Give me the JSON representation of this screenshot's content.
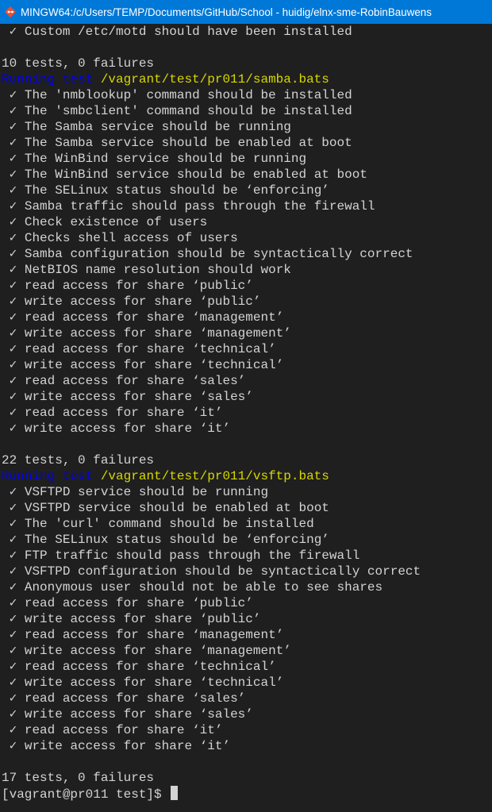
{
  "window": {
    "title": "MINGW64:/c/Users/TEMP/Documents/GitHub/School - huidig/elnx-sme-RobinBauwens",
    "icon": "git-bash-icon"
  },
  "terminal": {
    "lines": [
      {
        "kind": "pass",
        "text": " ✓ Custom /etc/motd should have been installed"
      },
      {
        "kind": "blank",
        "text": ""
      },
      {
        "kind": "summary",
        "text": "10 tests, 0 failures"
      },
      {
        "kind": "running",
        "label": "Running test",
        "path": "/vagrant/test/pr011/samba.bats"
      },
      {
        "kind": "pass",
        "text": " ✓ The 'nmblookup' command should be installed"
      },
      {
        "kind": "pass",
        "text": " ✓ The 'smbclient' command should be installed"
      },
      {
        "kind": "pass",
        "text": " ✓ The Samba service should be running"
      },
      {
        "kind": "pass",
        "text": " ✓ The Samba service should be enabled at boot"
      },
      {
        "kind": "pass",
        "text": " ✓ The WinBind service should be running"
      },
      {
        "kind": "pass",
        "text": " ✓ The WinBind service should be enabled at boot"
      },
      {
        "kind": "pass",
        "text": " ✓ The SELinux status should be ‘enforcing’"
      },
      {
        "kind": "pass",
        "text": " ✓ Samba traffic should pass through the firewall"
      },
      {
        "kind": "pass",
        "text": " ✓ Check existence of users"
      },
      {
        "kind": "pass",
        "text": " ✓ Checks shell access of users"
      },
      {
        "kind": "pass",
        "text": " ✓ Samba configuration should be syntactically correct"
      },
      {
        "kind": "pass",
        "text": " ✓ NetBIOS name resolution should work"
      },
      {
        "kind": "pass",
        "text": " ✓ read access for share ‘public’"
      },
      {
        "kind": "pass",
        "text": " ✓ write access for share ‘public’"
      },
      {
        "kind": "pass",
        "text": " ✓ read access for share ‘management’"
      },
      {
        "kind": "pass",
        "text": " ✓ write access for share ‘management’"
      },
      {
        "kind": "pass",
        "text": " ✓ read access for share ‘technical’"
      },
      {
        "kind": "pass",
        "text": " ✓ write access for share ‘technical’"
      },
      {
        "kind": "pass",
        "text": " ✓ read access for share ‘sales’"
      },
      {
        "kind": "pass",
        "text": " ✓ write access for share ‘sales’"
      },
      {
        "kind": "pass",
        "text": " ✓ read access for share ‘it’"
      },
      {
        "kind": "pass",
        "text": " ✓ write access for share ‘it’"
      },
      {
        "kind": "blank",
        "text": ""
      },
      {
        "kind": "summary",
        "text": "22 tests, 0 failures"
      },
      {
        "kind": "running",
        "label": "Running test",
        "path": "/vagrant/test/pr011/vsftp.bats"
      },
      {
        "kind": "pass",
        "text": " ✓ VSFTPD service should be running"
      },
      {
        "kind": "pass",
        "text": " ✓ VSFTPD service should be enabled at boot"
      },
      {
        "kind": "pass",
        "text": " ✓ The 'curl' command should be installed"
      },
      {
        "kind": "pass",
        "text": " ✓ The SELinux status should be ‘enforcing’"
      },
      {
        "kind": "pass",
        "text": " ✓ FTP traffic should pass through the firewall"
      },
      {
        "kind": "pass",
        "text": " ✓ VSFTPD configuration should be syntactically correct"
      },
      {
        "kind": "pass",
        "text": " ✓ Anonymous user should not be able to see shares"
      },
      {
        "kind": "pass",
        "text": " ✓ read access for share ‘public’"
      },
      {
        "kind": "pass",
        "text": " ✓ write access for share ‘public’"
      },
      {
        "kind": "pass",
        "text": " ✓ read access for share ‘management’"
      },
      {
        "kind": "pass",
        "text": " ✓ write access for share ‘management’"
      },
      {
        "kind": "pass",
        "text": " ✓ read access for share ‘technical’"
      },
      {
        "kind": "pass",
        "text": " ✓ write access for share ‘technical’"
      },
      {
        "kind": "pass",
        "text": " ✓ read access for share ‘sales’"
      },
      {
        "kind": "pass",
        "text": " ✓ write access for share ‘sales’"
      },
      {
        "kind": "pass",
        "text": " ✓ read access for share ‘it’"
      },
      {
        "kind": "pass",
        "text": " ✓ write access for share ‘it’"
      },
      {
        "kind": "blank",
        "text": ""
      },
      {
        "kind": "summary",
        "text": "17 tests, 0 failures"
      },
      {
        "kind": "prompt",
        "text": "[vagrant@pr011 test]$ "
      }
    ]
  },
  "colors": {
    "titlebar": "#0078d7",
    "background": "#1f1f1f",
    "foreground": "#d3d3d3",
    "running_label": "#0000ee",
    "running_path": "#d7d700"
  }
}
